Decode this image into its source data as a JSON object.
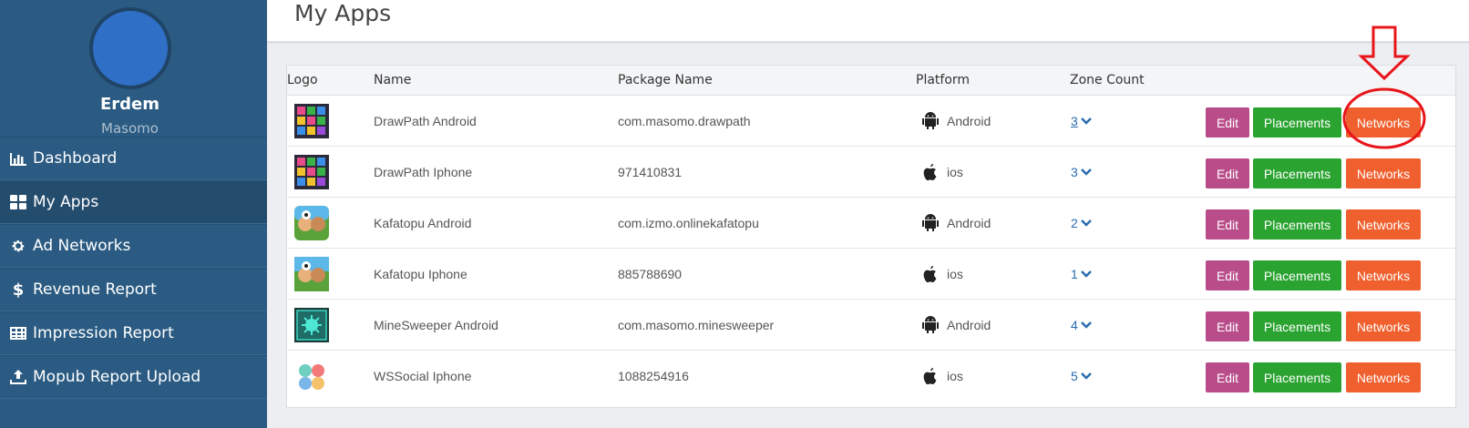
{
  "user": {
    "name": "Erdem",
    "org": "Masomo"
  },
  "nav": [
    {
      "label": "Dashboard",
      "icon": "bar-chart-icon"
    },
    {
      "label": "My Apps",
      "icon": "grid-icon",
      "active": true
    },
    {
      "label": "Ad Networks",
      "icon": "gear-icon"
    },
    {
      "label": "Revenue Report",
      "icon": "dollar-icon"
    },
    {
      "label": "Impression Report",
      "icon": "table-icon"
    },
    {
      "label": "Mopub Report Upload",
      "icon": "upload-icon"
    }
  ],
  "page": {
    "title": "My Apps"
  },
  "table": {
    "headers": {
      "logo": "Logo",
      "name": "Name",
      "package": "Package Name",
      "platform": "Platform",
      "zone": "Zone Count"
    },
    "rows": [
      {
        "name": "DrawPath Android",
        "package": "com.masomo.drawpath",
        "platform": "Android",
        "zone_count": "3"
      },
      {
        "name": "DrawPath Iphone",
        "package": "971410831",
        "platform": "ios",
        "zone_count": "3"
      },
      {
        "name": "Kafatopu Android",
        "package": "com.izmo.onlinekafatopu",
        "platform": "Android",
        "zone_count": "2"
      },
      {
        "name": "Kafatopu Iphone",
        "package": "885788690",
        "platform": "ios",
        "zone_count": "1"
      },
      {
        "name": "MineSweeper Android",
        "package": "com.masomo.minesweeper",
        "platform": "Android",
        "zone_count": "4"
      },
      {
        "name": "WSSocial Iphone",
        "package": "1088254916",
        "platform": "ios",
        "zone_count": "5"
      }
    ],
    "buttons": {
      "edit": "Edit",
      "placements": "Placements",
      "networks": "Networks"
    }
  },
  "colors": {
    "sidebar": "#2b5b82",
    "edit": "#b84d8a",
    "placements": "#2ba331",
    "networks": "#f0602e",
    "annotation": "#e8151b"
  }
}
